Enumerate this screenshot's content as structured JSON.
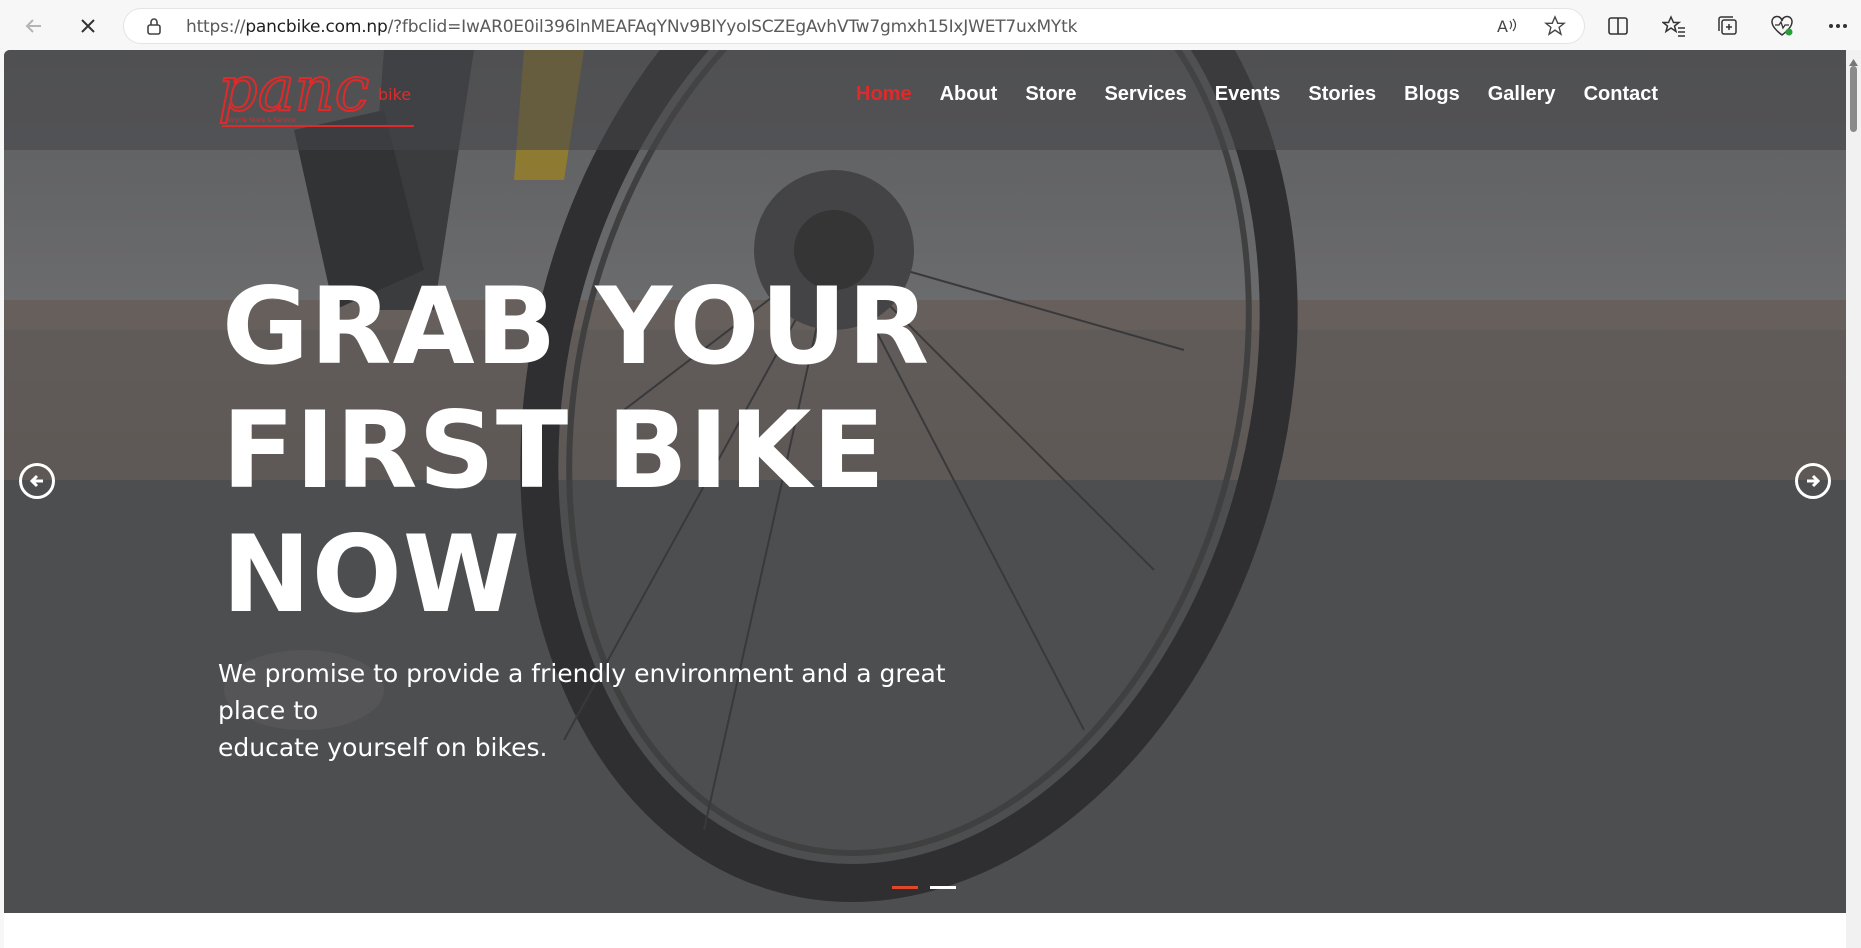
{
  "browser": {
    "url_prefix": "https://",
    "url_host": "pancbike.com.np",
    "url_rest": "/?fbclid=IwAR0E0il396lnMEAFAqYNv9BIYyoISCZEgAvhVTw7gmxh15IxJWET7uxMYtk",
    "icons": [
      "back-icon",
      "stop-icon",
      "lock-icon",
      "read-aloud-icon",
      "favorite-star-icon",
      "split-screen-icon",
      "favorites-icon",
      "collections-icon",
      "browser-essentials-icon",
      "more-icon"
    ]
  },
  "site": {
    "logo": {
      "text_main": "panc",
      "text_small": "bike",
      "tagline": "Bicycle Store & Service"
    },
    "nav": [
      {
        "label": "Home",
        "active": true
      },
      {
        "label": "About"
      },
      {
        "label": "Store"
      },
      {
        "label": "Services"
      },
      {
        "label": "Events"
      },
      {
        "label": "Stories"
      },
      {
        "label": "Blogs"
      },
      {
        "label": "Gallery"
      },
      {
        "label": "Contact"
      }
    ],
    "hero": {
      "title_line1": "GRAB YOUR",
      "title_line2": "FIRST BIKE",
      "title_line3": "NOW",
      "subtitle_line1": "We promise to provide a friendly environment and a great place to",
      "subtitle_line2": "educate yourself on bikes."
    },
    "colors": {
      "accent": "#e02a2a",
      "nav_overlay": "#464648"
    },
    "slider": {
      "slides": 2,
      "active_slide": 1
    }
  }
}
